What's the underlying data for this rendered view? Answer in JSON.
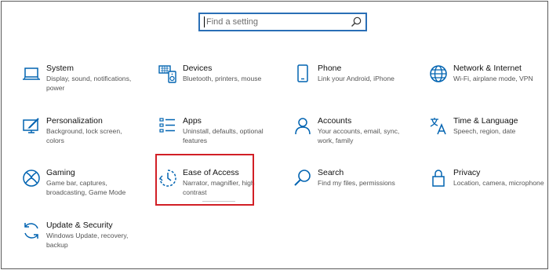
{
  "search": {
    "placeholder": "Find a setting"
  },
  "colors": {
    "accent": "#0063b1",
    "highlight": "#d21f26",
    "text": "#111111",
    "subtext": "#555555"
  },
  "tiles": [
    {
      "id": "system",
      "icon": "laptop-icon",
      "title": "System",
      "desc": "Display, sound, notifications, power"
    },
    {
      "id": "devices",
      "icon": "keyboard-speaker-icon",
      "title": "Devices",
      "desc": "Bluetooth, printers, mouse"
    },
    {
      "id": "phone",
      "icon": "phone-icon",
      "title": "Phone",
      "desc": "Link your Android, iPhone"
    },
    {
      "id": "network",
      "icon": "globe-icon",
      "title": "Network & Internet",
      "desc": "Wi-Fi, airplane mode, VPN"
    },
    {
      "id": "personalization",
      "icon": "paintbrush-monitor-icon",
      "title": "Personalization",
      "desc": "Background, lock screen, colors"
    },
    {
      "id": "apps",
      "icon": "app-list-icon",
      "title": "Apps",
      "desc": "Uninstall, defaults, optional features"
    },
    {
      "id": "accounts",
      "icon": "person-icon",
      "title": "Accounts",
      "desc": "Your accounts, email, sync, work, family"
    },
    {
      "id": "time",
      "icon": "language-icon",
      "title": "Time & Language",
      "desc": "Speech, region, date"
    },
    {
      "id": "gaming",
      "icon": "xbox-icon",
      "title": "Gaming",
      "desc": "Game bar, captures, broadcasting, Game Mode"
    },
    {
      "id": "ease",
      "icon": "ease-of-access-icon",
      "title": "Ease of Access",
      "desc": "Narrator, magnifier, high contrast"
    },
    {
      "id": "search",
      "icon": "search-icon",
      "title": "Search",
      "desc": "Find my files, permissions"
    },
    {
      "id": "privacy",
      "icon": "lock-icon",
      "title": "Privacy",
      "desc": "Location, camera, microphone"
    },
    {
      "id": "update",
      "icon": "sync-icon",
      "title": "Update & Security",
      "desc": "Windows Update, recovery, backup"
    }
  ]
}
